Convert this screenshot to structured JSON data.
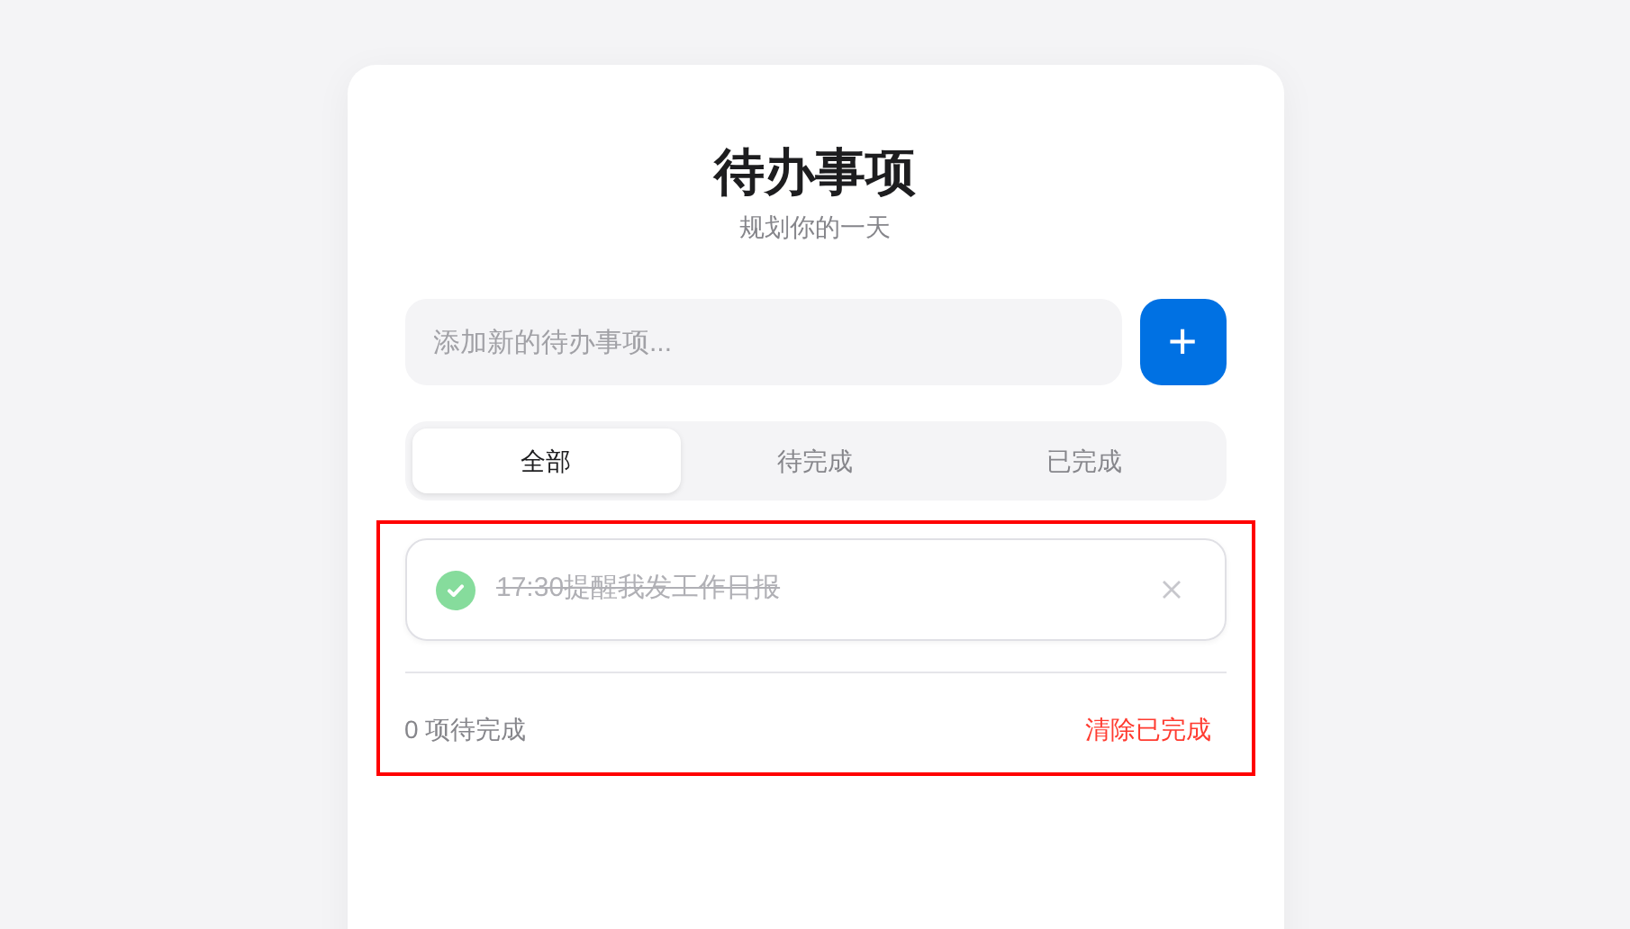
{
  "header": {
    "title": "待办事项",
    "subtitle": "规划你的一天"
  },
  "new_todo": {
    "placeholder": "添加新的待办事项...",
    "add_button": "+"
  },
  "filters": [
    {
      "label": "全部",
      "selected": true
    },
    {
      "label": "待完成",
      "selected": false
    },
    {
      "label": "已完成",
      "selected": false
    }
  ],
  "list_section": {
    "highlighted": true,
    "todos": [
      {
        "text": "17:30提醒我发工作日报",
        "completed": true
      }
    ],
    "remaining": "0 项待完成",
    "clear_button": "清除已完成"
  }
}
